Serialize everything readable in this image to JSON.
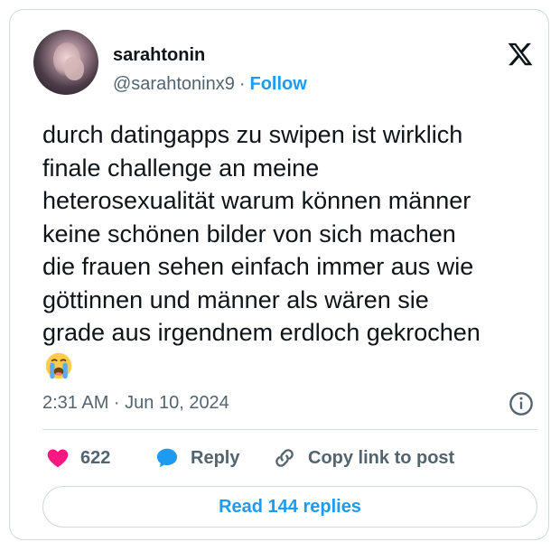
{
  "tweet": {
    "display_name": "sarahtonin",
    "handle": "@sarahtoninx9",
    "separator": "·",
    "follow_label": "Follow",
    "text": "durch datingapps zu swipen ist wirklich\nfinale challenge an meine\nheterosexualität warum können männer\nkeine schönen bilder von sich machen\ndie frauen sehen einfach immer aus wie\ngöttinnen und männer als wären sie\ngrade aus irgendnem erdloch gekrochen",
    "emoji_icon": "loudly-crying-face-icon",
    "timestamp": "2:31 AM · Jun 10, 2024"
  },
  "actions": {
    "like_count": "622",
    "reply_label": "Reply",
    "copy_link_label": "Copy link to post"
  },
  "footer": {
    "read_replies_label": "Read 144 replies"
  },
  "colors": {
    "accent": "#1d9bf0",
    "like": "#f91880",
    "secondary_text": "#536471",
    "border": "#cfd9de"
  }
}
